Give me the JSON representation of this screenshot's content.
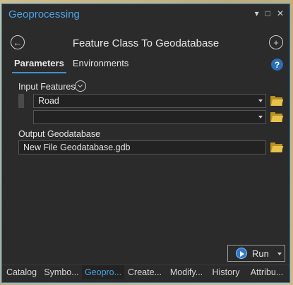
{
  "window": {
    "title": "Geoprocessing",
    "controls": [
      "▾",
      "□",
      "✕"
    ]
  },
  "header": {
    "tool_title": "Feature Class To Geodatabase"
  },
  "tabs": [
    {
      "label": "Parameters",
      "active": true
    },
    {
      "label": "Environments",
      "active": false
    }
  ],
  "params": {
    "input_features_label": "Input Features",
    "input_rows": [
      {
        "value": "Road"
      },
      {
        "value": ""
      }
    ],
    "output_label": "Output Geodatabase",
    "output_value": "New File Geodatabase.gdb"
  },
  "run": {
    "label": "Run"
  },
  "bottom_tabs": [
    {
      "label": "Catalog",
      "active": false
    },
    {
      "label": "Symbo...",
      "active": false
    },
    {
      "label": "Geopro...",
      "active": true
    },
    {
      "label": "Create...",
      "active": false
    },
    {
      "label": "Modify...",
      "active": false
    },
    {
      "label": "History",
      "active": false
    },
    {
      "label": "Attribu...",
      "active": false
    }
  ],
  "colors": {
    "accent": "#4aa3e8",
    "panel_bg": "#2b2b2b",
    "folder": "#e8c24a"
  },
  "icons": [
    "back-icon",
    "add-icon",
    "help-icon",
    "expand-icon",
    "folder-icon",
    "run-icon"
  ]
}
